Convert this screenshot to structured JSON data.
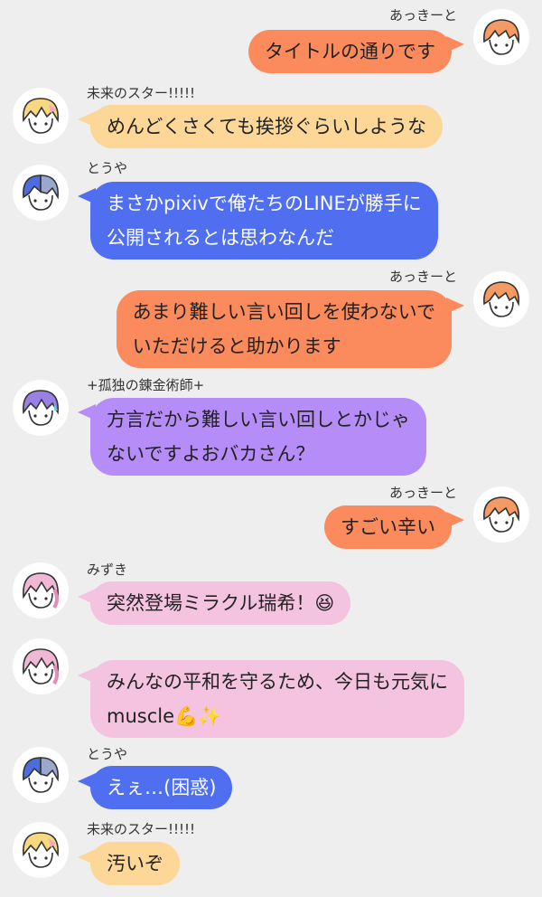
{
  "colors": {
    "background": "#eeeeee",
    "orange": "#fb8a5c",
    "yellow": "#fcd797",
    "blue": "#4f6ef0",
    "purple": "#b58cf8",
    "pink": "#f4c3df"
  },
  "messages": [
    {
      "side": "right",
      "sender": "あっきーと",
      "avatar": "akito-avatar",
      "color": "#fb8a5c",
      "lines": [
        "タイトルの通りです"
      ]
    },
    {
      "side": "left",
      "sender": "未来のスター!!!!!",
      "avatar": "tsukasa-avatar",
      "color": "#fcd797",
      "lines": [
        "めんどくさくても挨拶ぐらいしような"
      ]
    },
    {
      "side": "left",
      "sender": "とうや",
      "avatar": "toya-avatar",
      "color": "#4f6ef0",
      "lines": [
        "まさかpixivで俺たちのLINEが勝手に",
        "公開されるとは思わなんだ"
      ]
    },
    {
      "side": "right",
      "sender": "あっきーと",
      "avatar": "akito-avatar",
      "color": "#fb8a5c",
      "lines": [
        "あまり難しい言い回しを使わないで",
        "いただけると助かります"
      ]
    },
    {
      "side": "left",
      "sender": "+孤独の錬金術師+",
      "avatar": "rui-avatar",
      "color": "#b58cf8",
      "lines": [
        "方言だから難しい言い回しとかじゃ",
        "ないですよおバカさん？"
      ]
    },
    {
      "side": "right",
      "sender": "あっきーと",
      "avatar": "akito-avatar",
      "color": "#fb8a5c",
      "lines": [
        "すごい辛い"
      ]
    },
    {
      "side": "left",
      "sender": "みずき",
      "avatar": "mizuki-avatar",
      "color": "#f4c3df",
      "lines": [
        "突然登場ミラクル瑞希！😆"
      ]
    },
    {
      "side": "left",
      "sender": "",
      "avatar": "mizuki-avatar",
      "color": "#f4c3df",
      "lines": [
        "みんなの平和を守るため、今日も元気に",
        "muscle💪✨"
      ]
    },
    {
      "side": "left",
      "sender": "とうや",
      "avatar": "toya-avatar",
      "color": "#4f6ef0",
      "lines": [
        "えぇ…(困惑)"
      ]
    },
    {
      "side": "left",
      "sender": "未来のスター!!!!!",
      "avatar": "tsukasa-avatar",
      "color": "#fcd797",
      "lines": [
        "汚いぞ"
      ]
    }
  ]
}
